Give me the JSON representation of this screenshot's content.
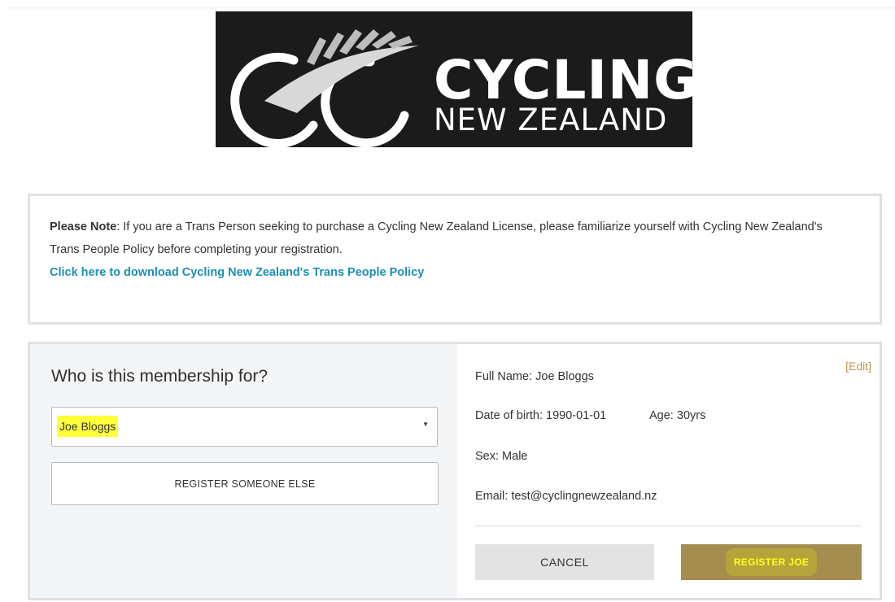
{
  "logo": {
    "line1": "CYCLING",
    "line2": "NEW ZEALAND",
    "background": "#1b1b1b"
  },
  "notice": {
    "label": "Please Note",
    "text": ": If you are a Trans Person seeking to purchase a Cycling New Zealand License, please familiarize yourself with Cycling New Zealand's Trans People Policy before completing your registration.",
    "link": "Click here to download Cycling New Zealand's Trans People Policy",
    "link_color": "#1b8fb3"
  },
  "membership": {
    "title": "Who is this membership for?",
    "selected_member": "Joe Bloggs",
    "register_else_label": "REGISTER SOMEONE ELSE",
    "edit_label": "[Edit]",
    "details": {
      "full_name_label": "Full Name:",
      "full_name": "Joe Bloggs",
      "dob_label": "Date of birth:",
      "dob": "1990-01-01",
      "age_label": "Age:",
      "age": "30yrs",
      "sex_label": "Sex:",
      "sex": "Male",
      "email_label": "Email:",
      "email": "test@cyclingnewzealand.nz"
    },
    "cancel_label": "CANCEL",
    "register_label": "REGISTER JOE",
    "accent_color": "#a48d4f",
    "highlight_color": "#ffff3a"
  }
}
